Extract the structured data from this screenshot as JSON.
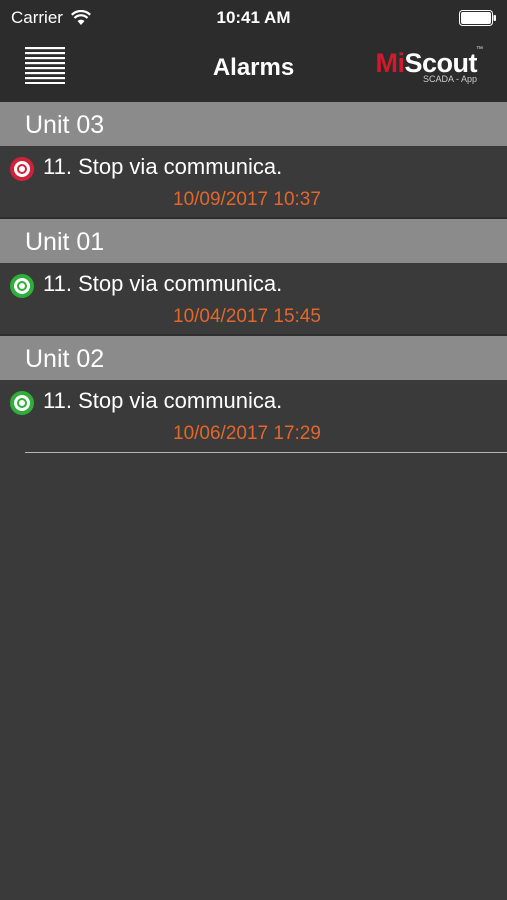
{
  "status_bar": {
    "carrier": "Carrier",
    "time": "10:41 AM",
    "wifi_icon": "wifi-icon",
    "battery_icon": "battery-icon"
  },
  "nav": {
    "menu_icon": "hamburger-menu-icon",
    "title": "Alarms",
    "logo": {
      "mi": "Mi",
      "scout": "Scout",
      "tm": "™",
      "subtitle": "SCADA - App"
    }
  },
  "colors": {
    "background": "#3a3a3b",
    "bar": "#2c2c2d",
    "group_header": "#8b8b8c",
    "timestamp": "#e2672a",
    "alarm_red": "#d0233a",
    "alarm_green": "#2fae3a",
    "logo_red": "#d21a2a"
  },
  "groups": [
    {
      "name": "Unit 03",
      "alarms": [
        {
          "status": "red",
          "message": "11. Stop via communica.",
          "timestamp": "10/09/2017 10:37"
        }
      ]
    },
    {
      "name": "Unit 01",
      "alarms": [
        {
          "status": "green",
          "message": "11. Stop via communica.",
          "timestamp": "10/04/2017 15:45"
        }
      ]
    },
    {
      "name": "Unit 02",
      "alarms": [
        {
          "status": "green",
          "message": "11. Stop via communica.",
          "timestamp": "10/06/2017 17:29"
        }
      ]
    }
  ]
}
